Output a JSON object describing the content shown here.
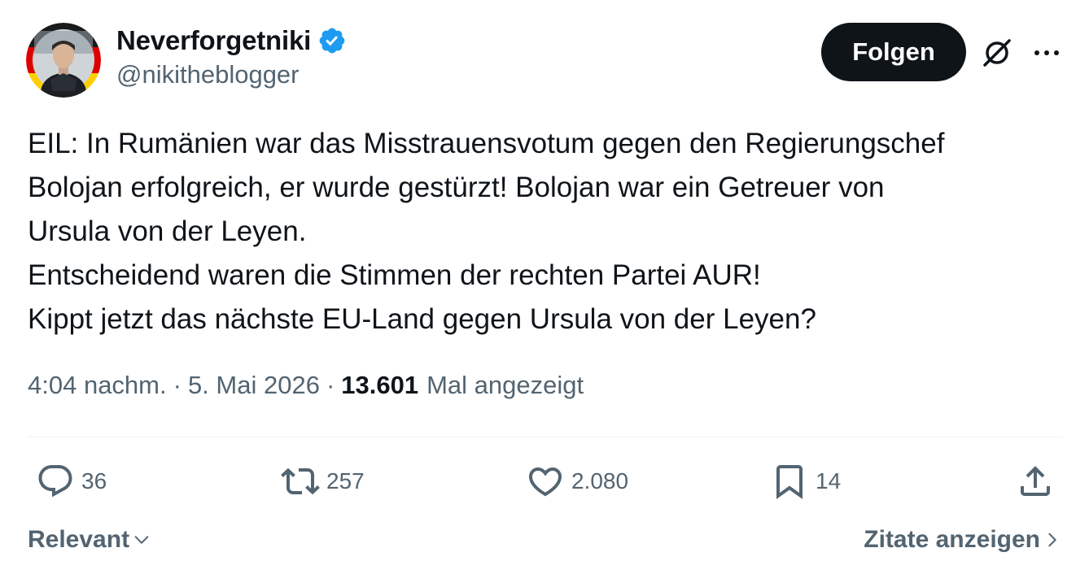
{
  "author": {
    "display_name": "Neverforgetniki",
    "handle": "@nikitheblogger",
    "verified": true
  },
  "follow_button_label": "Folgen",
  "tweet": {
    "lines": [
      "EIL: In Rumänien war das Misstrauensvotum gegen den Regierungschef",
      "Bolojan erfolgreich, er wurde gestürzt! Bolojan war ein Getreuer von",
      "Ursula von der Leyen.",
      "Entscheidend waren die Stimmen der rechten Partei AUR!",
      "Kippt jetzt das nächste EU-Land gegen Ursula von der Leyen?"
    ]
  },
  "meta": {
    "time": "4:04 nachm.",
    "date": "5. Mai 2026",
    "separator": "·",
    "views_count": "13.601",
    "views_label": "Mal angezeigt"
  },
  "actions": {
    "replies": "36",
    "reposts": "257",
    "likes": "2.080",
    "bookmarks": "14"
  },
  "footer": {
    "sort_label": "Relevant",
    "quotes_label": "Zitate anzeigen"
  },
  "colors": {
    "text_primary": "#0f1419",
    "text_secondary": "#536471",
    "verified_blue": "#1d9bf0",
    "button_bg": "#0f1419",
    "divider": "#eff3f4"
  },
  "icons": {
    "verified": "verified-badge-icon",
    "grok": "grok-icon",
    "more": "more-dots-icon",
    "reply": "reply-icon",
    "repost": "repost-icon",
    "like": "heart-icon",
    "bookmark": "bookmark-icon",
    "share": "share-icon"
  }
}
